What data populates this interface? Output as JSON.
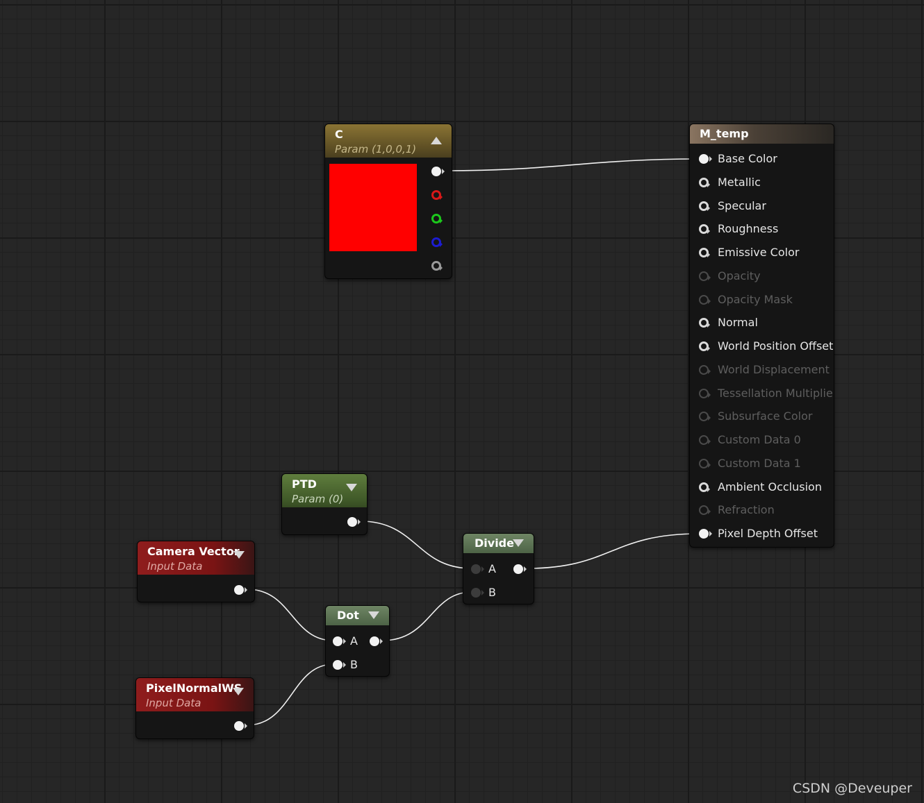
{
  "nodes": {
    "vector_param": {
      "name": "C",
      "subtitle": "Param (1,0,0,1)",
      "swatch_color": "#ff0000"
    },
    "scalar_param": {
      "name": "PTD",
      "subtitle": "Param (0)"
    },
    "camera_vector": {
      "name": "Camera Vector",
      "subtitle": "Input Data"
    },
    "pixel_normal": {
      "name": "PixelNormalWS",
      "subtitle": "Input Data"
    },
    "dot": {
      "name": "Dot",
      "input_a": "A",
      "input_b": "B"
    },
    "divide": {
      "name": "Divide",
      "input_a": "A",
      "input_b": "B"
    },
    "material": {
      "name": "M_temp",
      "inputs": [
        {
          "label": "Base Color",
          "state": "connected"
        },
        {
          "label": "Metallic",
          "state": "active"
        },
        {
          "label": "Specular",
          "state": "active"
        },
        {
          "label": "Roughness",
          "state": "active"
        },
        {
          "label": "Emissive Color",
          "state": "active"
        },
        {
          "label": "Opacity",
          "state": "disabled"
        },
        {
          "label": "Opacity Mask",
          "state": "disabled"
        },
        {
          "label": "Normal",
          "state": "active"
        },
        {
          "label": "World Position Offset",
          "state": "active"
        },
        {
          "label": "World Displacement",
          "state": "disabled"
        },
        {
          "label": "Tessellation Multiplier",
          "state": "disabled"
        },
        {
          "label": "Subsurface Color",
          "state": "disabled"
        },
        {
          "label": "Custom Data 0",
          "state": "disabled"
        },
        {
          "label": "Custom Data 1",
          "state": "disabled"
        },
        {
          "label": "Ambient Occlusion",
          "state": "active"
        },
        {
          "label": "Refraction",
          "state": "disabled"
        },
        {
          "label": "Pixel Depth Offset",
          "state": "connected"
        }
      ]
    }
  },
  "watermark": "CSDN @Deveuper",
  "colors": {
    "background": "#262626",
    "param_header": "#8a7434",
    "scalar_header": "#5f7d3d",
    "input_header": "#8f1d1d",
    "operator_header": "#6e8564",
    "wire": "#ffffff"
  }
}
